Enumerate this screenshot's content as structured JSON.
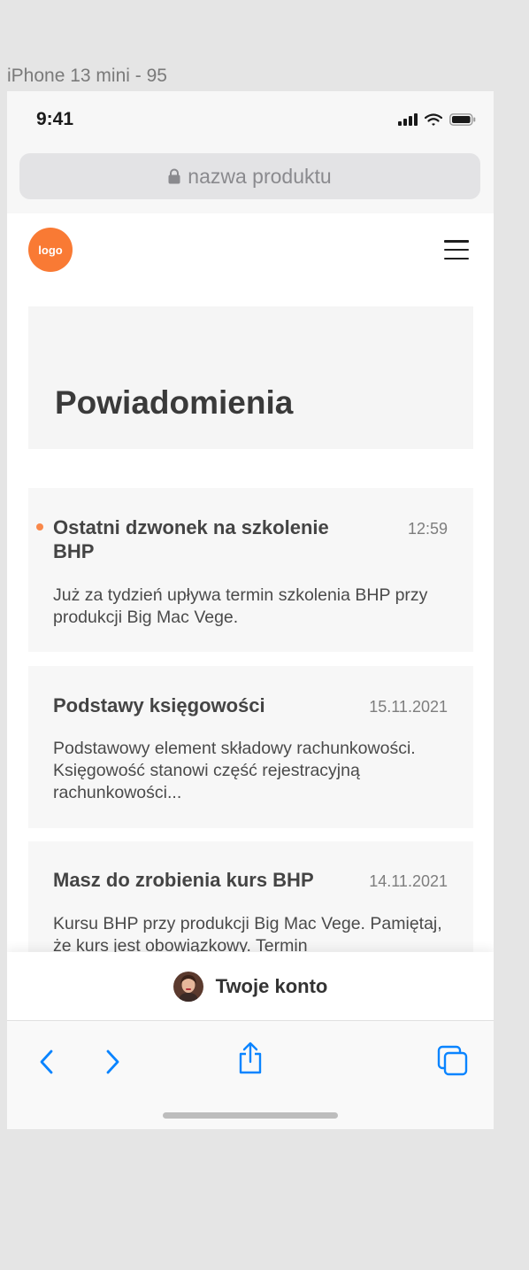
{
  "frame_label": "iPhone 13 mini - 95",
  "status_bar": {
    "time": "9:41"
  },
  "url_bar": {
    "text": "nazwa produktu"
  },
  "header": {
    "logo_text": "logo"
  },
  "page": {
    "title": "Powiadomienia"
  },
  "notifications": [
    {
      "title": "Ostatni dzwonek na szkolenie BHP",
      "time": "12:59",
      "body": "Już za tydzień upływa termin szkolenia BHP przy produkcji Big Mac Vege.",
      "unread": true
    },
    {
      "title": "Podstawy księgowości",
      "time": "15.11.2021",
      "body": "Podstawowy element składowy rachunkowości. Księgowość stanowi część rejestracyjną rachunkowości...",
      "unread": false
    },
    {
      "title": "Masz do zrobienia kurs BHP",
      "time": "14.11.2021",
      "body": "Kursu BHP przy produkcji Big Mac Vege. Pamiętaj, że kurs jest obowiązkowy. Termin",
      "unread": false
    }
  ],
  "account_bar": {
    "label": "Twoje konto"
  },
  "colors": {
    "accent": "#f97a34",
    "ios_blue": "#0a84ff",
    "card_bg": "#f7f7f7"
  },
  "icons": {
    "lock": "lock-icon",
    "menu": "hamburger-menu-icon",
    "back": "chevron-left-icon",
    "forward": "chevron-right-icon",
    "share": "share-icon",
    "tabs": "tabs-icon"
  }
}
